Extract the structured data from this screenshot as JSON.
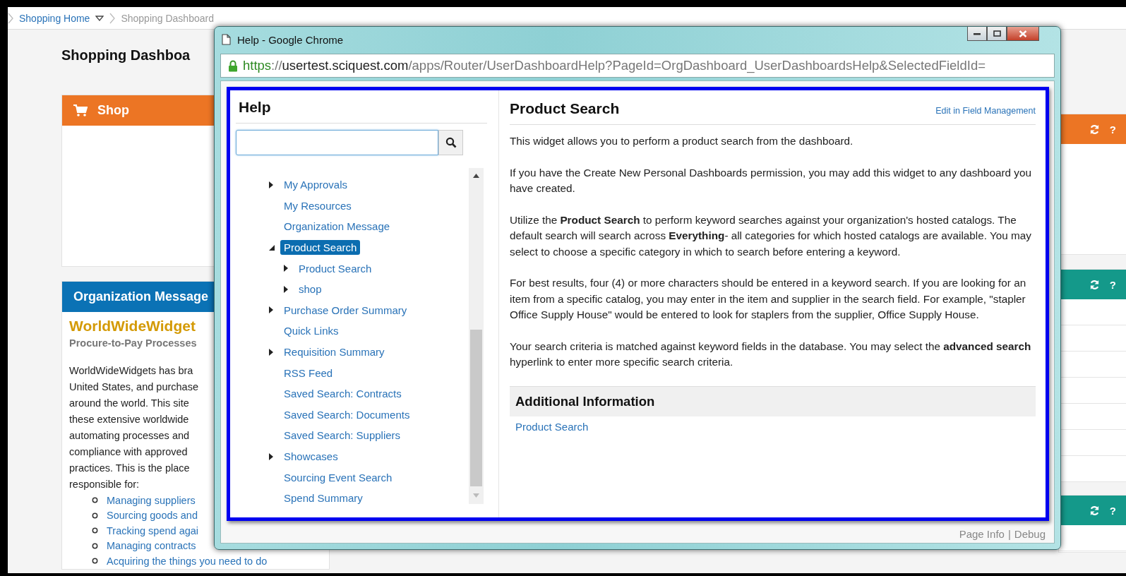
{
  "breadcrumb": {
    "home": "Shopping Home",
    "current": "Shopping Dashboard"
  },
  "page_title": "Shopping Dashboa",
  "left_widgets": [
    {
      "title": "Shop",
      "color": "#ec7524",
      "kind": "shop"
    },
    {
      "title": "Organization Message",
      "color": "#0b72b5",
      "kind": "message",
      "heading": "WorldWideWidget",
      "subheading": "Procure-to-Pay Processes",
      "lines": [
        "WorldWideWidgets has bra",
        "United States, and purchase",
        "around the world. This site",
        "these extensive worldwide",
        "automating processes and",
        "compliance with approved",
        "practices. This is the place",
        "responsible for:"
      ],
      "bullets": [
        "Managing suppliers",
        "Sourcing goods and",
        "Tracking spend agai",
        "Managing contracts",
        "Acquiring the things you need to do"
      ]
    }
  ],
  "right_widgets": [
    {
      "color": "#ec7524",
      "help": "?"
    },
    {
      "color": "#14998a",
      "help": "?"
    },
    {
      "color": "#14998a",
      "help": "?"
    }
  ],
  "popup": {
    "title": "Help - Google Chrome",
    "url": {
      "scheme": "https",
      "separator": "://",
      "host": "usertest.sciquest.com",
      "path": "/apps/Router/UserDashboardHelp?PageId=OrgDashboard_UserDashboardsHelp&SelectedFieldId="
    },
    "help_heading": "Help",
    "tree": [
      {
        "label": "My Approvals",
        "kind": "folder",
        "expanded": false,
        "selected": false
      },
      {
        "label": "My Resources",
        "kind": "leaf",
        "selected": false
      },
      {
        "label": "Organization Message",
        "kind": "leaf",
        "selected": false
      },
      {
        "label": "Product Search",
        "kind": "folder",
        "expanded": true,
        "selected": true,
        "children": [
          {
            "label": "Product Search",
            "kind": "folder",
            "expanded": false,
            "selected": false
          },
          {
            "label": "shop",
            "kind": "folder",
            "expanded": false,
            "selected": false
          }
        ]
      },
      {
        "label": "Purchase Order Summary",
        "kind": "folder",
        "expanded": false,
        "selected": false
      },
      {
        "label": "Quick Links",
        "kind": "leaf",
        "selected": false
      },
      {
        "label": "Requisition Summary",
        "kind": "folder",
        "expanded": false,
        "selected": false
      },
      {
        "label": "RSS Feed",
        "kind": "leaf",
        "selected": false
      },
      {
        "label": "Saved Search: Contracts",
        "kind": "leaf",
        "selected": false
      },
      {
        "label": "Saved Search: Documents",
        "kind": "leaf",
        "selected": false
      },
      {
        "label": "Saved Search: Suppliers",
        "kind": "leaf",
        "selected": false
      },
      {
        "label": "Showcases",
        "kind": "folder",
        "expanded": false,
        "selected": false
      },
      {
        "label": "Sourcing Event Search",
        "kind": "leaf",
        "selected": false
      },
      {
        "label": "Spend Summary",
        "kind": "leaf",
        "selected": false
      }
    ],
    "article": {
      "title": "Product Search",
      "edit_link": "Edit in Field Management",
      "paragraphs": [
        "This widget allows you to perform a product search from the dashboard.",
        "If you have the Create New Personal Dashboards permission, you may add this widget to any dashboard you have created.",
        "Utilize the **Product Search** to perform keyword searches against your organization's hosted catalogs.  The default search will search across **Everything**- all categories for which hosted catalogs are available.  You may select to choose a specific category in which to search before entering a keyword.",
        "For best results, four (4) or more characters should be entered in a keyword search.  If you are looking for an item from a specific catalog, you may enter in the item and supplier in the search field.  For example, \"stapler Office Supply House\" would be entered to look for staplers from the supplier, Office Supply House.",
        "Your search criteria is matched against keyword fields in the database. You may select the **advanced search** hyperlink to enter more specific search criteria."
      ],
      "additional_heading": "Additional Information",
      "additional_links": [
        "Product Search"
      ]
    },
    "footer": {
      "page_info": "Page Info",
      "separator": "|",
      "debug": "Debug"
    }
  }
}
